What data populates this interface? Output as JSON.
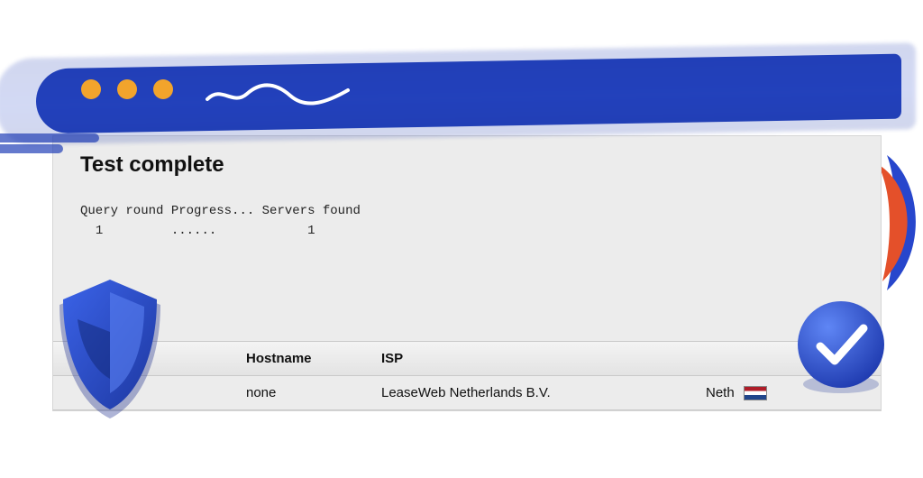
{
  "title": "Test complete",
  "query_header": {
    "round_label": "Query round",
    "progress_label": "Progress...",
    "servers_label": "Servers found",
    "rows": [
      {
        "round": "1",
        "progress": "......",
        "servers": "1"
      }
    ]
  },
  "table": {
    "headers": {
      "hostname": "Hostname",
      "isp": "ISP"
    },
    "rows": [
      {
        "hostname": "none",
        "isp": "LeaseWeb Netherlands B.V.",
        "country_partial": "Neth"
      }
    ]
  },
  "decor": {
    "window_dot": "window-dot",
    "squiggle": "address-squiggle",
    "shield": "shield-badge",
    "check": "checkmark-badge",
    "leaf": "leaf-decoration"
  }
}
